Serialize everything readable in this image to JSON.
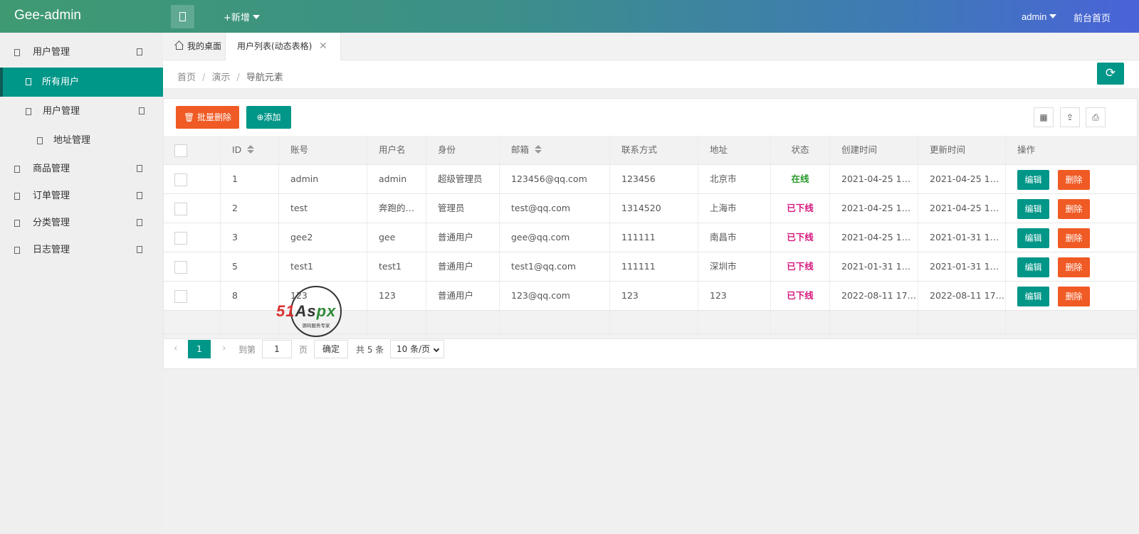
{
  "header": {
    "logo": "Gee-admin",
    "add_new": "+新增",
    "user": "admin",
    "front_link": "前台首页"
  },
  "sidebar": {
    "items": [
      {
        "label": "用户管理"
      },
      {
        "label": "所有用户"
      },
      {
        "label": "用户管理"
      },
      {
        "label": "地址管理"
      },
      {
        "label": "商品管理"
      },
      {
        "label": "订单管理"
      },
      {
        "label": "分类管理"
      },
      {
        "label": "日志管理"
      }
    ]
  },
  "tabs": {
    "home": "我的桌面",
    "active": "用户列表(动态表格)",
    "close": "✕"
  },
  "breadcrumb": {
    "items": [
      "首页",
      "演示",
      "导航元素"
    ],
    "sep": "/"
  },
  "toolbar": {
    "batch_delete": "批量删除",
    "add": "添加"
  },
  "table": {
    "headers": [
      "ID",
      "账号",
      "用户名",
      "身份",
      "邮箱",
      "联系方式",
      "地址",
      "状态",
      "创建时间",
      "更新时间",
      "操作"
    ],
    "rows": [
      {
        "id": "1",
        "account": "admin",
        "username": "admin",
        "role": "超级管理员",
        "email": "123456@qq.com",
        "phone": "123456",
        "address": "北京市",
        "status": "在线",
        "created": "2021-04-25 1…",
        "updated": "2021-04-25 1…"
      },
      {
        "id": "2",
        "account": "test",
        "username": "奔跑的…",
        "role": "管理员",
        "email": "test@qq.com",
        "phone": "1314520",
        "address": "上海市",
        "status": "已下线",
        "created": "2021-04-25 1…",
        "updated": "2021-04-25 1…"
      },
      {
        "id": "3",
        "account": "gee2",
        "username": "gee",
        "role": "普通用户",
        "email": "gee@qq.com",
        "phone": "111111",
        "address": "南昌市",
        "status": "已下线",
        "created": "2021-04-25 1…",
        "updated": "2021-01-31 1…"
      },
      {
        "id": "5",
        "account": "test1",
        "username": "test1",
        "role": "普通用户",
        "email": "test1@qq.com",
        "phone": "111111",
        "address": "深圳市",
        "status": "已下线",
        "created": "2021-01-31 1…",
        "updated": "2021-01-31 1…"
      },
      {
        "id": "8",
        "account": "123",
        "username": "123",
        "role": "普通用户",
        "email": "123@qq.com",
        "phone": "123",
        "address": "123",
        "status": "已下线",
        "created": "2022-08-11 17…",
        "updated": "2022-08-11 17…"
      }
    ],
    "edit_label": "编辑",
    "delete_label": "删除"
  },
  "pager": {
    "current": "1",
    "goto": "到第",
    "page_input": "1",
    "page_unit": "页",
    "confirm": "确定",
    "total": "共 5 条",
    "page_size": "10 条/页"
  },
  "watermark": {
    "brand_a": "51",
    "brand_b": "As",
    "brand_c": "px",
    "sub": "源码服务专家"
  },
  "colors": {
    "primary": "#009688",
    "danger": "#f05a24",
    "online": "#2a9a2a",
    "offline": "#d6197e"
  }
}
